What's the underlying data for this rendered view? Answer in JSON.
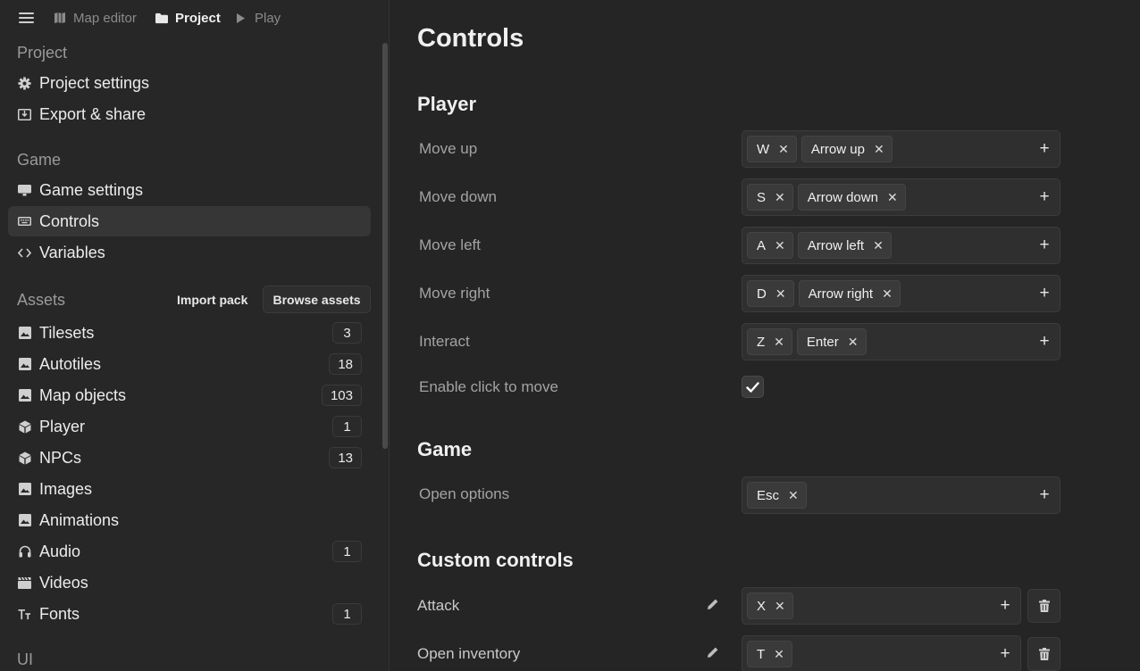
{
  "topbar": {
    "breadcrumbs": [
      {
        "label": "Map editor",
        "icon": "map-icon"
      },
      {
        "label": "Project",
        "icon": "folder-icon"
      },
      {
        "label": "Play",
        "icon": "play-icon"
      }
    ]
  },
  "sidebar": {
    "project": {
      "title": "Project",
      "items": [
        {
          "label": "Project settings",
          "icon": "gear-icon"
        },
        {
          "label": "Export & share",
          "icon": "export-icon"
        }
      ]
    },
    "game": {
      "title": "Game",
      "items": [
        {
          "label": "Game settings",
          "icon": "monitor-icon"
        },
        {
          "label": "Controls",
          "icon": "keyboard-icon",
          "selected": true
        },
        {
          "label": "Variables",
          "icon": "code-icon"
        }
      ]
    },
    "assets": {
      "title": "Assets",
      "import_label": "Import pack",
      "browse_label": "Browse assets",
      "items": [
        {
          "label": "Tilesets",
          "icon": "image-icon",
          "count": "3"
        },
        {
          "label": "Autotiles",
          "icon": "image-icon",
          "count": "18"
        },
        {
          "label": "Map objects",
          "icon": "image-icon",
          "count": "103"
        },
        {
          "label": "Player",
          "icon": "cube-icon",
          "count": "1"
        },
        {
          "label": "NPCs",
          "icon": "cube-icon",
          "count": "13"
        },
        {
          "label": "Images",
          "icon": "image-icon"
        },
        {
          "label": "Animations",
          "icon": "image-icon"
        },
        {
          "label": "Audio",
          "icon": "headphones-icon",
          "count": "1"
        },
        {
          "label": "Videos",
          "icon": "clapperboard-icon"
        },
        {
          "label": "Fonts",
          "icon": "font-icon",
          "count": "1"
        }
      ]
    },
    "ui": {
      "title": "UI"
    }
  },
  "main": {
    "title": "Controls",
    "player": {
      "title": "Player",
      "rows": [
        {
          "label": "Move up",
          "keys": [
            "W",
            "Arrow up"
          ]
        },
        {
          "label": "Move down",
          "keys": [
            "S",
            "Arrow down"
          ]
        },
        {
          "label": "Move left",
          "keys": [
            "A",
            "Arrow left"
          ]
        },
        {
          "label": "Move right",
          "keys": [
            "D",
            "Arrow right"
          ]
        },
        {
          "label": "Interact",
          "keys": [
            "Z",
            "Enter"
          ]
        }
      ],
      "click_to_move": {
        "label": "Enable click to move",
        "checked": true
      }
    },
    "game": {
      "title": "Game",
      "rows": [
        {
          "label": "Open options",
          "keys": [
            "Esc"
          ]
        }
      ]
    },
    "custom": {
      "title": "Custom controls",
      "rows": [
        {
          "label": "Attack",
          "keys": [
            "X"
          ]
        },
        {
          "label": "Open inventory",
          "keys": [
            "T"
          ]
        }
      ]
    }
  },
  "glyphs": {
    "remove": "✕",
    "add": "+"
  },
  "colors": {
    "background": "#252525",
    "sidebar": "#272727",
    "selected": "#363636",
    "field": "#2f2f2f",
    "chip": "#3a3a3a"
  }
}
